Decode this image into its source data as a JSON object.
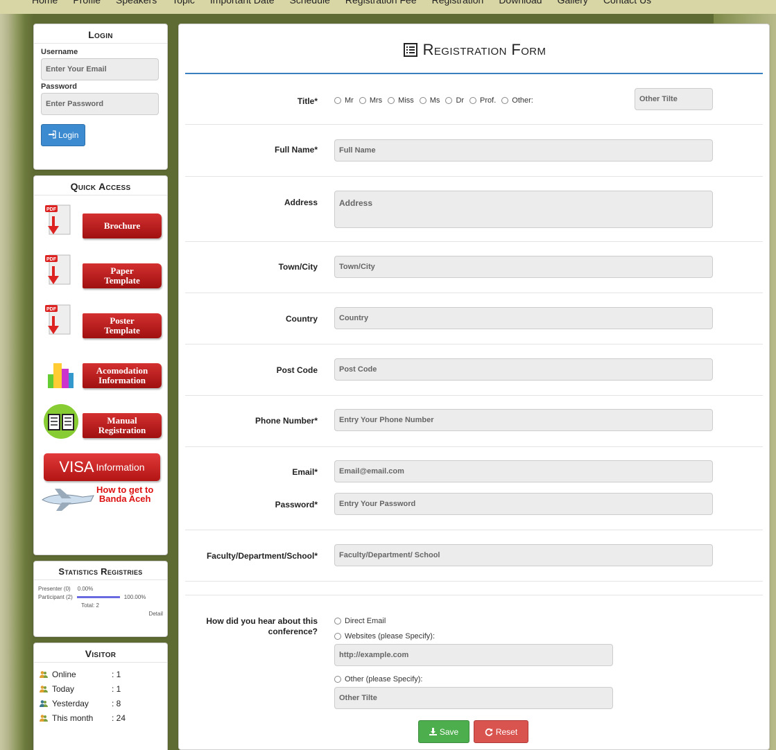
{
  "nav": {
    "items": [
      "Home",
      "Profile",
      "Speakers",
      "Topic",
      "Important Date",
      "Schedule",
      "Registration Fee",
      "Registration",
      "Download",
      "Gallery",
      "Contact Us"
    ]
  },
  "login": {
    "heading": "Login",
    "username_label": "Username",
    "username_placeholder": "Enter Your Email",
    "password_label": "Password",
    "password_placeholder": "Enter Password",
    "button_label": "Login"
  },
  "quick_access": {
    "heading": "Quick Access",
    "brochure": "Brochure",
    "paper_template_1": "Paper",
    "paper_template_2": "Template",
    "poster_template_1": "Poster",
    "poster_template_2": "Template",
    "accommodation_1": "Acomodation",
    "accommodation_2": "Information",
    "manual_1": "Manual",
    "manual_2": "Registration",
    "visa_big": "VISA",
    "visa_small": "Information",
    "howto_1": "How to get to",
    "howto_2": "Banda Aceh"
  },
  "statistics": {
    "heading": "Statistics Registries",
    "presenter_label": "Presenter (0)",
    "presenter_pct": "0.00%",
    "presenter_fraction": 0,
    "participant_label": "Participant (2)",
    "participant_pct": "100.00%",
    "participant_fraction": 1,
    "total": "Total: 2",
    "detail": "Detail"
  },
  "visitor": {
    "heading": "Visitor",
    "rows": [
      {
        "label": "Online",
        "value": ": 1"
      },
      {
        "label": "Today",
        "value": ": 1"
      },
      {
        "label": "Yesterday",
        "value": ": 8"
      },
      {
        "label": "This month",
        "value": ": 24"
      }
    ]
  },
  "form": {
    "title": "Registration Form",
    "title_label": "Title*",
    "title_options": [
      "Mr",
      "Mrs",
      "Miss",
      "Ms",
      "Dr",
      "Prof.",
      "Other:"
    ],
    "other_title_placeholder": "Other Tilte",
    "full_name_label": "Full Name*",
    "full_name_placeholder": "Full Name",
    "address_label": "Address",
    "address_placeholder": "Address",
    "town_label": "Town/City",
    "town_placeholder": "Town/City",
    "country_label": "Country",
    "country_placeholder": "Country",
    "postcode_label": "Post Code",
    "postcode_placeholder": "Post Code",
    "phone_label": "Phone Number*",
    "phone_placeholder": "Entry Your Phone Number",
    "email_label": "Email*",
    "email_placeholder": "Email@email.com",
    "password_label": "Password*",
    "password_placeholder": "Entry Your Password",
    "faculty_label": "Faculty/Department/School*",
    "faculty_placeholder": "Faculty/Department/ School",
    "hear_label_1": "How did you hear about this",
    "hear_label_2": "conference?",
    "hear_direct": "Direct Email",
    "hear_websites": "Websites (please Specify):",
    "hear_websites_placeholder": "http://example.com",
    "hear_other": "Other (please Specify):",
    "hear_other_placeholder": "Other Tilte",
    "save_label": "Save",
    "reset_label": "Reset"
  },
  "colors": {
    "accent_blue": "#3a7fc0",
    "login_button": "#3c8bd0",
    "save_button": "#4cae4c",
    "reset_button": "#d9534f",
    "banner_red": "#c21e1e"
  }
}
